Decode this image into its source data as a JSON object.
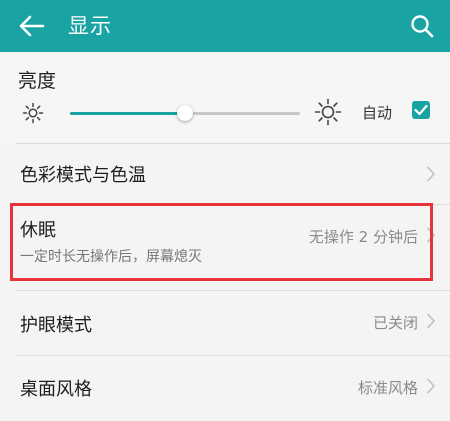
{
  "appbar": {
    "title": "显示",
    "back_icon": "arrow-left-icon",
    "search_icon": "search-icon",
    "color": "#1aa3a3"
  },
  "brightness": {
    "label": "亮度",
    "level_fraction": 0.5,
    "auto_label": "自动",
    "auto_checked": true
  },
  "rows": [
    {
      "id": "color-mode",
      "title": "色彩模式与色温",
      "value": "",
      "subtitle": ""
    },
    {
      "id": "sleep",
      "title": "休眠",
      "subtitle": "一定时长无操作后，屏幕熄灭",
      "value": "无操作 2 分钟后"
    },
    {
      "id": "eye-comfort",
      "title": "护眼模式",
      "value": "已关闭",
      "subtitle": ""
    },
    {
      "id": "desktop-style",
      "title": "桌面风格",
      "value": "标准风格",
      "subtitle": ""
    }
  ],
  "highlight_color": "#e8333a"
}
